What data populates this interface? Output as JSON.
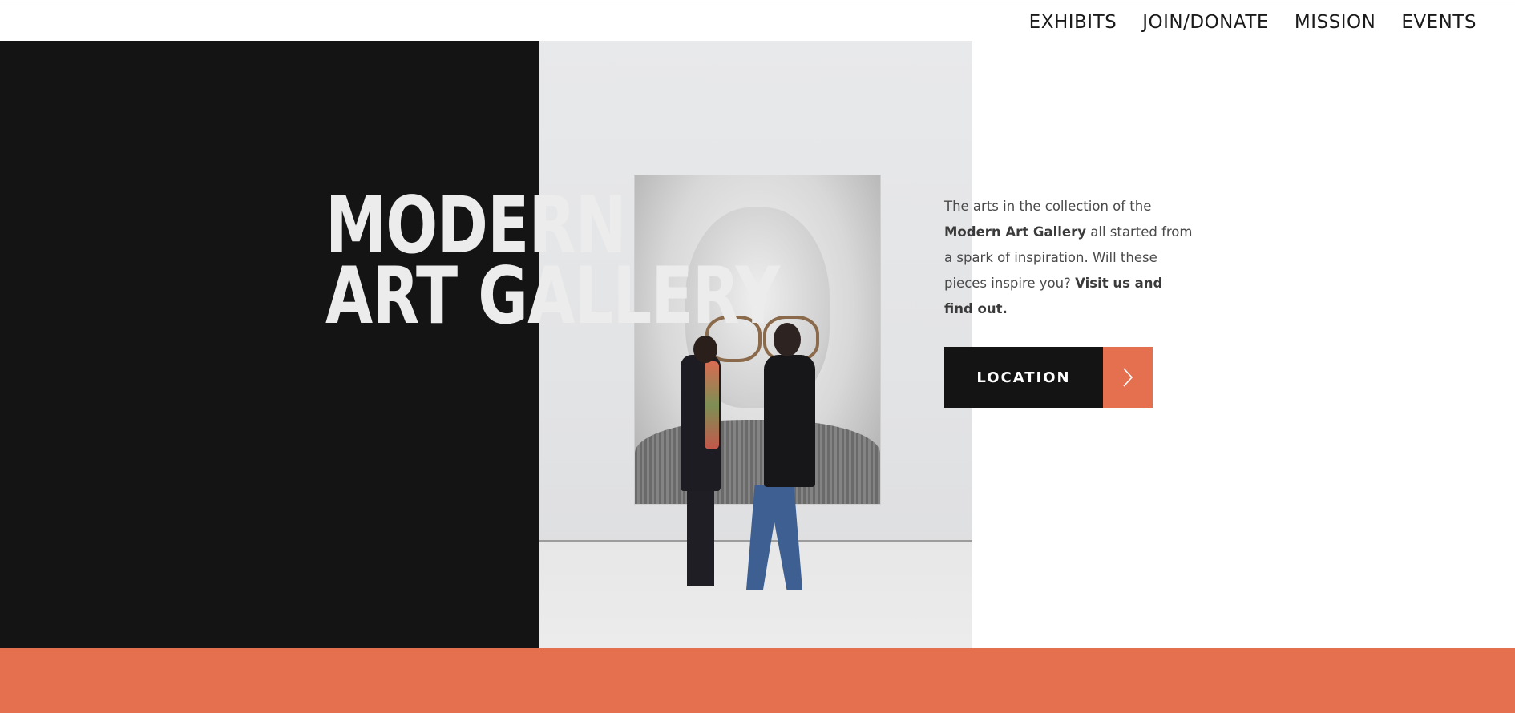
{
  "nav": {
    "items": [
      {
        "label": "EXHIBITS"
      },
      {
        "label": "JOIN/DONATE"
      },
      {
        "label": "MISSION"
      },
      {
        "label": "EVENTS"
      }
    ]
  },
  "hero": {
    "title_line1": "MODERN",
    "title_line2": "ART GALLERY",
    "copy": {
      "part1": "The arts in the collection of the ",
      "bold1": "Modern Art Gallery",
      "part2": " all started from a spark of inspiration. Will these pieces inspire you? ",
      "bold2": "Visit us and find out."
    },
    "cta_label": "LOCATION",
    "cta_icon": "chevron-right-icon"
  },
  "colors": {
    "accent": "#e5704f",
    "dark": "#141414",
    "text": "#4a4a4a"
  }
}
